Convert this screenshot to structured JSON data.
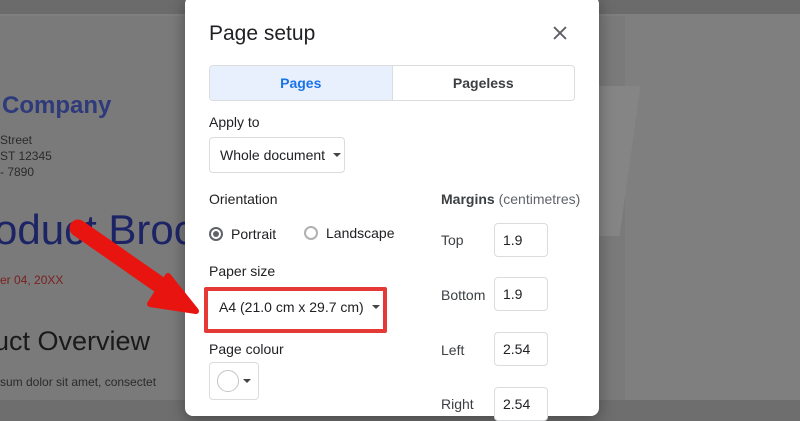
{
  "background_doc": {
    "company": "Company",
    "address_lines": [
      "Street",
      "ST 12345",
      "- 7890"
    ],
    "heading": "oduct Broc",
    "date": "er 04, 20XX",
    "section": "uct Overview",
    "body": "sum dolor sit amet, consectet"
  },
  "dialog": {
    "title": "Page setup",
    "close_icon": "close-icon",
    "tabs": [
      {
        "label": "Pages",
        "active": true
      },
      {
        "label": "Pageless",
        "active": false
      }
    ],
    "apply_to": {
      "label": "Apply to",
      "value": "Whole document"
    },
    "orientation": {
      "label": "Orientation",
      "options": [
        {
          "label": "Portrait",
          "selected": true
        },
        {
          "label": "Landscape",
          "selected": false
        }
      ]
    },
    "paper_size": {
      "label": "Paper size",
      "value": "A4 (21.0 cm x 29.7 cm)"
    },
    "page_colour": {
      "label": "Page colour",
      "value": "#ffffff"
    },
    "margins": {
      "label": "Margins",
      "unit": "(centimetres)",
      "fields": [
        {
          "label": "Top",
          "value": "1.9"
        },
        {
          "label": "Bottom",
          "value": "1.9"
        },
        {
          "label": "Left",
          "value": "2.54"
        },
        {
          "label": "Right",
          "value": "2.54"
        }
      ]
    }
  },
  "annotation": {
    "highlight_color": "#e53935",
    "arrow_color": "#e8140f"
  }
}
